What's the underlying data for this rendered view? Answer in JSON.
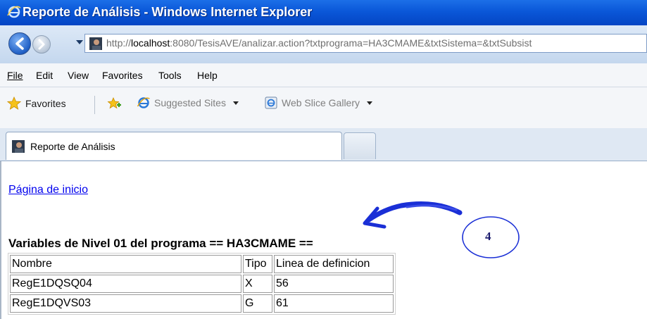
{
  "window": {
    "title": "Reporte de Análisis - Windows Internet Explorer"
  },
  "address": {
    "prefix": "http://",
    "host": "localhost",
    "rest": ":8080/TesisAVE/analizar.action?txtprograma=HA3CMAME&txtSistema=&txtSubsist"
  },
  "menu": {
    "items": [
      "File",
      "Edit",
      "View",
      "Favorites",
      "Tools",
      "Help"
    ]
  },
  "favorites_bar": {
    "favorites_label": "Favorites",
    "suggested_sites": "Suggested Sites",
    "web_slice_gallery": "Web Slice Gallery"
  },
  "tab": {
    "label": "Reporte de Análisis"
  },
  "page": {
    "home_link": "Página de inicio",
    "heading": "Variables de Nivel 01 del programa == HA3CMAME ==",
    "table": {
      "headers": [
        "Nombre",
        "Tipo",
        "Linea de definicion"
      ],
      "rows": [
        [
          "RegE1DQSQ04",
          "X",
          "56"
        ],
        [
          "RegE1DQVS03",
          "G",
          "61"
        ]
      ]
    }
  },
  "annotation": {
    "number": "4",
    "color": "#1a2fd6"
  },
  "colors": {
    "titlebar": "#0a57d8",
    "link": "#0000ee"
  }
}
